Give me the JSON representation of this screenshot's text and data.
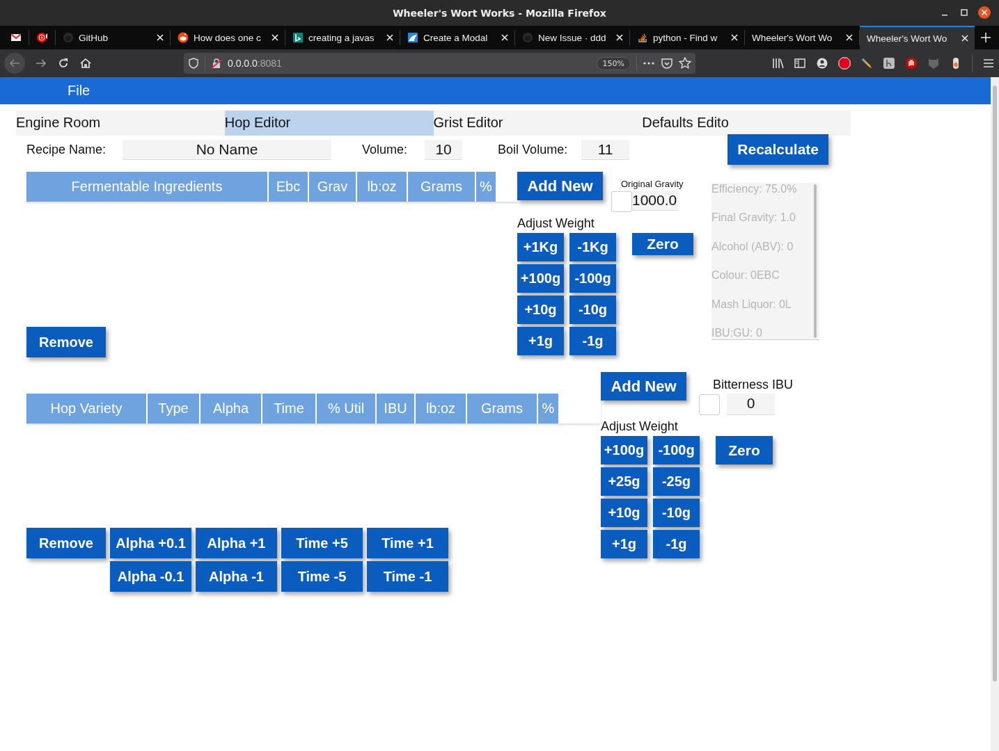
{
  "window": {
    "title": "Wheeler's Wort Works - Mozilla Firefox"
  },
  "browser_tabs": [
    {
      "kind": "mail",
      "selected": false
    },
    {
      "kind": "music",
      "selected": false
    },
    {
      "kind": "octocat",
      "label": "GitHub",
      "selected": false
    },
    {
      "kind": "alien",
      "label": "How does one c",
      "selected": false
    },
    {
      "kind": "letter",
      "label": "creating a javas",
      "selected": false
    },
    {
      "kind": "bird",
      "label": "Create a Modal",
      "selected": false
    },
    {
      "kind": "octocat",
      "label": "New Issue · ddd",
      "selected": false
    },
    {
      "kind": "stack",
      "label": "python - Find w",
      "selected": false
    },
    {
      "kind": "plain",
      "label": "Wheeler's Wort Wo",
      "selected": false
    },
    {
      "kind": "plain",
      "label": "Wheeler's Wort Wo",
      "selected": true
    }
  ],
  "address": {
    "host": "0.0.0.0",
    "port": ":8081",
    "zoom": "150%"
  },
  "menu": [
    "File"
  ],
  "app_tabs": [
    {
      "label": "Engine Room",
      "selected": false
    },
    {
      "label": "Hop Editor",
      "selected": true
    },
    {
      "label": "Grist Editor",
      "selected": false
    },
    {
      "label": "Defaults Edito",
      "selected": false
    }
  ],
  "recipe": {
    "name_label": "Recipe Name:",
    "name": "No Name",
    "volume_label": "Volume:",
    "volume": "10",
    "boil_label": "Boil Volume:",
    "boil_volume": "11",
    "recalculate": "Recalculate"
  },
  "fermentables": {
    "columns": [
      "Fermentable Ingredients",
      "Ebc",
      "Grav",
      "lb:oz",
      "Grams",
      "%"
    ],
    "remove": "Remove"
  },
  "grist_controls": {
    "add": "Add New",
    "gravity_label": "Original Gravity",
    "checked": false,
    "gravity": "1000.0",
    "adjust_label": "Adjust Weight",
    "buttons": [
      [
        "+1Kg",
        "-1Kg"
      ],
      [
        "+100g",
        "-100g"
      ],
      [
        "+10g",
        "-10g"
      ],
      [
        "+1g",
        "-1g"
      ]
    ],
    "zero": "Zero"
  },
  "stats": [
    "Efficiency: 75.0%",
    "Final Gravity: 1.0",
    "Alcohol (ABV): 0",
    "Colour: 0EBC",
    "Mash Liquor: 0L",
    "IBU:GU: 0"
  ],
  "hops": {
    "columns": [
      "Hop Variety",
      "Type",
      "Alpha",
      "Time",
      "% Util",
      "IBU",
      "lb:oz",
      "Grams",
      "%"
    ],
    "remove": "Remove",
    "adjust": [
      [
        "Alpha +0.1",
        "Alpha -0.1"
      ],
      [
        "Alpha +1",
        "Alpha -1"
      ],
      [
        "Time +5",
        "Time -5"
      ],
      [
        "Time +1",
        "Time -1"
      ]
    ]
  },
  "hop_controls": {
    "add": "Add New",
    "bitterness_label": "Bitterness IBU",
    "checked": false,
    "bitterness": "0",
    "adjust_label": "Adjust Weight",
    "buttons": [
      [
        "+100g",
        "-100g"
      ],
      [
        "+25g",
        "-25g"
      ],
      [
        "+10g",
        "-10g"
      ],
      [
        "+1g",
        "-1g"
      ]
    ],
    "zero": "Zero"
  }
}
